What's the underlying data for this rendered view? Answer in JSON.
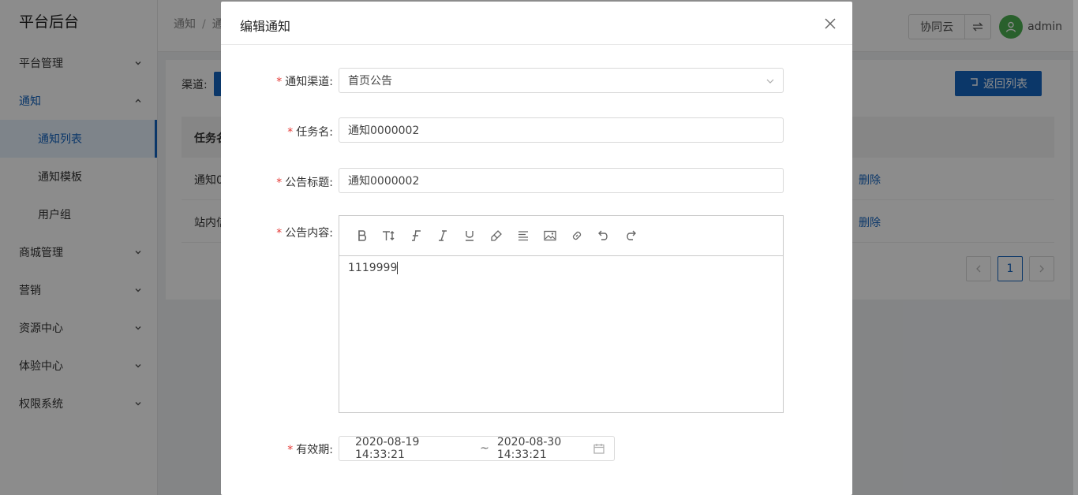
{
  "sidebar": {
    "brand": "平台后台",
    "items": [
      {
        "label": "平台管理"
      },
      {
        "label": "通知"
      },
      {
        "label": "商城管理"
      },
      {
        "label": "营销"
      },
      {
        "label": "资源中心"
      },
      {
        "label": "体验中心"
      },
      {
        "label": "权限系统"
      }
    ],
    "sub_items": [
      {
        "label": "通知列表"
      },
      {
        "label": "通知模板"
      },
      {
        "label": "用户组"
      }
    ]
  },
  "topbar": {
    "breadcrumb": [
      "通知",
      "通"
    ],
    "workspace_btn": "协同云",
    "user": "admin"
  },
  "panel": {
    "channel_label": "渠道:",
    "back_label": "返回列表",
    "table_header": "任务名",
    "rows": [
      {
        "name": "通知0",
        "delete": "删除"
      },
      {
        "name": "站内信",
        "delete": "删除"
      }
    ],
    "current_page": "1"
  },
  "modal": {
    "title": "编辑通知",
    "fields": {
      "channel": {
        "label": "通知渠道:",
        "value": "首页公告"
      },
      "task_name": {
        "label": "任务名:",
        "value": "通知0000002"
      },
      "notice_title": {
        "label": "公告标题:",
        "value": "通知0000002"
      },
      "content": {
        "label": "公告内容:",
        "value": "1119999"
      },
      "validity": {
        "label": "有效期:",
        "start": "2020-08-19 14:33:21",
        "separator": "~",
        "end": "2020-08-30 14:33:21"
      }
    },
    "toolbar_icons": [
      "bold-icon",
      "font-size-icon",
      "font-family-icon",
      "italic-icon",
      "underline-icon",
      "highlight-icon",
      "align-icon",
      "image-icon",
      "link-icon",
      "undo-icon",
      "redo-icon"
    ]
  },
  "colors": {
    "primary": "#1565c0",
    "required": "#e53935",
    "avatar": "#4caf50"
  }
}
